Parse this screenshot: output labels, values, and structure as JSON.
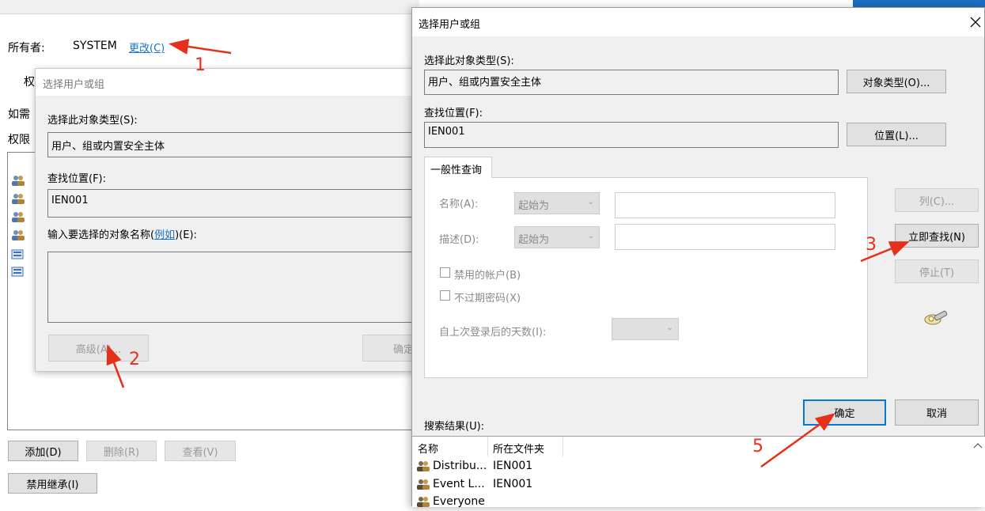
{
  "bg_window": {
    "owner_label": "所有者:",
    "owner_value": "SYSTEM",
    "owner_change_link": "更改(C)",
    "tab_fragment": "权",
    "line_if_fragment": "如需",
    "line_perm_fragment": "权限",
    "add_button": "添加(D)",
    "remove_button": "删除(R)",
    "view_button": "查看(V)",
    "disable_inherit_button": "禁用继承(I)"
  },
  "dialog_small": {
    "title": "选择用户或组",
    "object_type_label": "选择此对象类型(S):",
    "object_type_value": "用户、组或内置安全主体",
    "location_label": "查找位置(F):",
    "location_value": "IEN001",
    "enter_names_prefix": "输入要选择的对象名称(",
    "enter_names_link": "例如",
    "enter_names_suffix": ")(E):",
    "advanced_button": "高级(A)...",
    "ok_button_fragment": "确定"
  },
  "dialog_main": {
    "title": "选择用户或组",
    "object_type_label": "选择此对象类型(S):",
    "object_type_value": "用户、组或内置安全主体",
    "object_types_button": "对象类型(O)...",
    "location_label": "查找位置(F):",
    "location_value": "IEN001",
    "locations_button": "位置(L)...",
    "tab_common_queries": "一般性查询",
    "name_label": "名称(A):",
    "name_mode": "起始为",
    "desc_label": "描述(D):",
    "desc_mode": "起始为",
    "disabled_accounts": "禁用的帐户(B)",
    "non_expiring_pw": "不过期密码(X)",
    "days_since_logon": "自上次登录后的天数(I):",
    "columns_button": "列(C)...",
    "find_now_button": "立即查找(N)",
    "stop_button": "停止(T)",
    "ok_button": "确定",
    "cancel_button": "取消",
    "results_label": "搜索结果(U):",
    "results_columns": [
      "名称",
      "所在文件夹"
    ],
    "results_rows": [
      {
        "name": "Distribu...",
        "folder": "IEN001"
      },
      {
        "name": "Event L...",
        "folder": "IEN001"
      },
      {
        "name": "Everyone",
        "folder": ""
      }
    ]
  },
  "annotations": {
    "n1": "1",
    "n2": "2",
    "n3": "3",
    "n5": "5",
    "color": "#e5301c"
  },
  "icons": [
    "user-group-icon",
    "computer-icon",
    "search-flashlight-icon",
    "close-icon",
    "chevron-down-icon",
    "scroll-up-icon"
  ]
}
